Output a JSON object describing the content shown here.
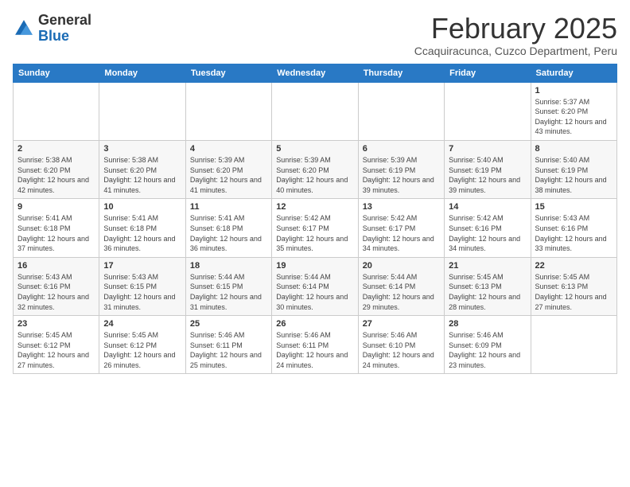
{
  "logo": {
    "general": "General",
    "blue": "Blue"
  },
  "title": "February 2025",
  "subtitle": "Ccaquiracunca, Cuzco Department, Peru",
  "weekdays": [
    "Sunday",
    "Monday",
    "Tuesday",
    "Wednesday",
    "Thursday",
    "Friday",
    "Saturday"
  ],
  "weeks": [
    [
      {
        "day": "",
        "info": ""
      },
      {
        "day": "",
        "info": ""
      },
      {
        "day": "",
        "info": ""
      },
      {
        "day": "",
        "info": ""
      },
      {
        "day": "",
        "info": ""
      },
      {
        "day": "",
        "info": ""
      },
      {
        "day": "1",
        "info": "Sunrise: 5:37 AM\nSunset: 6:20 PM\nDaylight: 12 hours and 43 minutes."
      }
    ],
    [
      {
        "day": "2",
        "info": "Sunrise: 5:38 AM\nSunset: 6:20 PM\nDaylight: 12 hours and 42 minutes."
      },
      {
        "day": "3",
        "info": "Sunrise: 5:38 AM\nSunset: 6:20 PM\nDaylight: 12 hours and 41 minutes."
      },
      {
        "day": "4",
        "info": "Sunrise: 5:39 AM\nSunset: 6:20 PM\nDaylight: 12 hours and 41 minutes."
      },
      {
        "day": "5",
        "info": "Sunrise: 5:39 AM\nSunset: 6:20 PM\nDaylight: 12 hours and 40 minutes."
      },
      {
        "day": "6",
        "info": "Sunrise: 5:39 AM\nSunset: 6:19 PM\nDaylight: 12 hours and 39 minutes."
      },
      {
        "day": "7",
        "info": "Sunrise: 5:40 AM\nSunset: 6:19 PM\nDaylight: 12 hours and 39 minutes."
      },
      {
        "day": "8",
        "info": "Sunrise: 5:40 AM\nSunset: 6:19 PM\nDaylight: 12 hours and 38 minutes."
      }
    ],
    [
      {
        "day": "9",
        "info": "Sunrise: 5:41 AM\nSunset: 6:18 PM\nDaylight: 12 hours and 37 minutes."
      },
      {
        "day": "10",
        "info": "Sunrise: 5:41 AM\nSunset: 6:18 PM\nDaylight: 12 hours and 36 minutes."
      },
      {
        "day": "11",
        "info": "Sunrise: 5:41 AM\nSunset: 6:18 PM\nDaylight: 12 hours and 36 minutes."
      },
      {
        "day": "12",
        "info": "Sunrise: 5:42 AM\nSunset: 6:17 PM\nDaylight: 12 hours and 35 minutes."
      },
      {
        "day": "13",
        "info": "Sunrise: 5:42 AM\nSunset: 6:17 PM\nDaylight: 12 hours and 34 minutes."
      },
      {
        "day": "14",
        "info": "Sunrise: 5:42 AM\nSunset: 6:16 PM\nDaylight: 12 hours and 34 minutes."
      },
      {
        "day": "15",
        "info": "Sunrise: 5:43 AM\nSunset: 6:16 PM\nDaylight: 12 hours and 33 minutes."
      }
    ],
    [
      {
        "day": "16",
        "info": "Sunrise: 5:43 AM\nSunset: 6:16 PM\nDaylight: 12 hours and 32 minutes."
      },
      {
        "day": "17",
        "info": "Sunrise: 5:43 AM\nSunset: 6:15 PM\nDaylight: 12 hours and 31 minutes."
      },
      {
        "day": "18",
        "info": "Sunrise: 5:44 AM\nSunset: 6:15 PM\nDaylight: 12 hours and 31 minutes."
      },
      {
        "day": "19",
        "info": "Sunrise: 5:44 AM\nSunset: 6:14 PM\nDaylight: 12 hours and 30 minutes."
      },
      {
        "day": "20",
        "info": "Sunrise: 5:44 AM\nSunset: 6:14 PM\nDaylight: 12 hours and 29 minutes."
      },
      {
        "day": "21",
        "info": "Sunrise: 5:45 AM\nSunset: 6:13 PM\nDaylight: 12 hours and 28 minutes."
      },
      {
        "day": "22",
        "info": "Sunrise: 5:45 AM\nSunset: 6:13 PM\nDaylight: 12 hours and 27 minutes."
      }
    ],
    [
      {
        "day": "23",
        "info": "Sunrise: 5:45 AM\nSunset: 6:12 PM\nDaylight: 12 hours and 27 minutes."
      },
      {
        "day": "24",
        "info": "Sunrise: 5:45 AM\nSunset: 6:12 PM\nDaylight: 12 hours and 26 minutes."
      },
      {
        "day": "25",
        "info": "Sunrise: 5:46 AM\nSunset: 6:11 PM\nDaylight: 12 hours and 25 minutes."
      },
      {
        "day": "26",
        "info": "Sunrise: 5:46 AM\nSunset: 6:11 PM\nDaylight: 12 hours and 24 minutes."
      },
      {
        "day": "27",
        "info": "Sunrise: 5:46 AM\nSunset: 6:10 PM\nDaylight: 12 hours and 24 minutes."
      },
      {
        "day": "28",
        "info": "Sunrise: 5:46 AM\nSunset: 6:09 PM\nDaylight: 12 hours and 23 minutes."
      },
      {
        "day": "",
        "info": ""
      }
    ]
  ]
}
